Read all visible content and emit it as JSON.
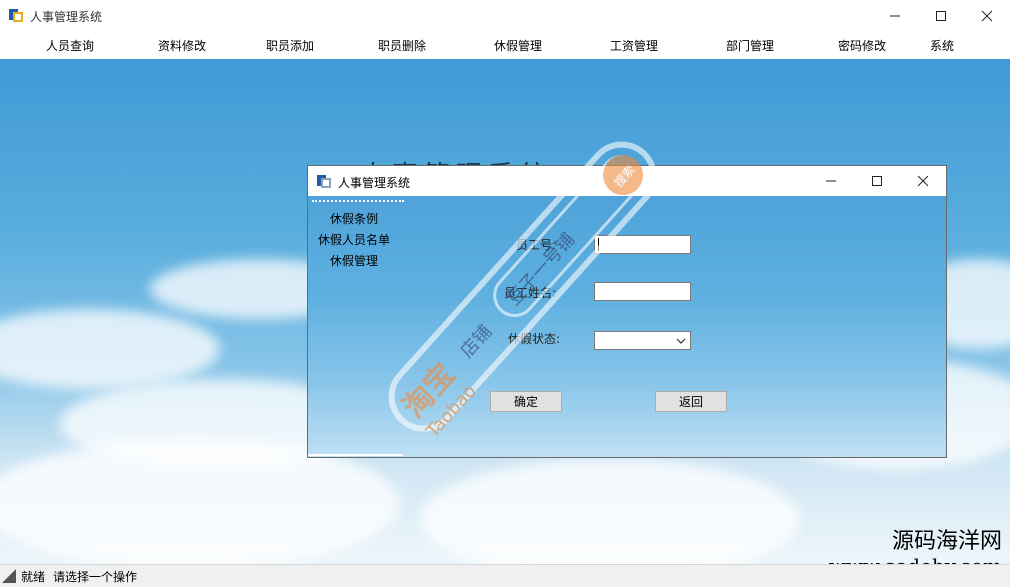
{
  "window": {
    "title": "人事管理系统"
  },
  "menu": [
    "人员查询",
    "资料修改",
    "职员添加",
    "职员删除",
    "休假管理",
    "工资管理",
    "部门管理",
    "密码修改",
    "系统"
  ],
  "background_title": "人事管理系统",
  "child": {
    "title": "人事管理系统",
    "nav": [
      "休假条例",
      "休假人员名单",
      "休假管理"
    ],
    "form": {
      "employee_id_label": "员工号:",
      "employee_id_value": "",
      "employee_name_label": "员工姓名:",
      "employee_name_value": "",
      "leave_status_label": "休假状态:",
      "leave_status_value": ""
    },
    "buttons": {
      "ok": "确定",
      "back": "返回"
    }
  },
  "status": {
    "ready": "就绪",
    "hint": "请选择一个操作"
  },
  "watermark": {
    "taobao_cn": "淘宝",
    "taobao_en": "Taobao",
    "shop": "店铺",
    "shop_name": "豆子一号铺",
    "search": "搜索"
  },
  "corner_brand": {
    "name": "源码海洋网",
    "url": "www.codehy.com"
  },
  "colors": {
    "accent_sky": "#4a9fd8",
    "watermark_orange": "#f08a3c"
  }
}
